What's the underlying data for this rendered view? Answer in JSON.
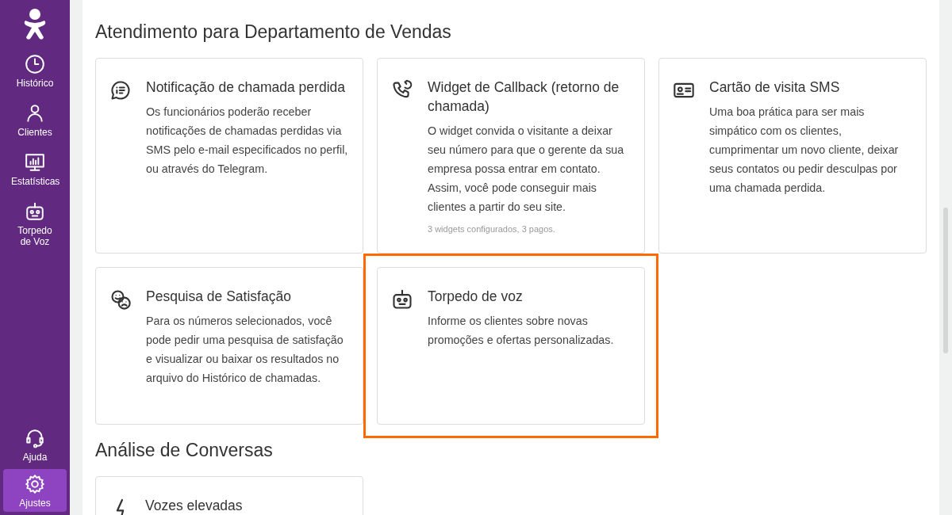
{
  "sidebar": {
    "top_items": [
      {
        "label": "Histórico",
        "selected": false
      },
      {
        "label": "Clientes",
        "selected": false
      },
      {
        "label": "Estatísticas",
        "selected": false
      },
      {
        "label": "Torpedo de Voz",
        "selected": false
      }
    ],
    "bottom_items": [
      {
        "label": "Ajuda",
        "selected": false
      },
      {
        "label": "Ajustes",
        "selected": true
      }
    ]
  },
  "sections": [
    {
      "title": "Atendimento para Departamento de Vendas",
      "cards": [
        {
          "title": "Notificação de chamada perdida",
          "description": "Os funcionários poderão receber notificações de chamadas perdidas via SMS pelo e-mail especificados no perfil, ou através do Telegram.",
          "highlighted": false
        },
        {
          "title": "Widget de Callback (retorno de chamada)",
          "description": "O widget convida o visitante a deixar seu número para que o gerente da sua empresa possa entrar em contato. Assim, você pode conseguir mais clientes a partir do seu site.",
          "note": "3 widgets configurados, 3 pagos.",
          "highlighted": false
        },
        {
          "title": "Cartão de visita SMS",
          "description": "Uma boa prática para ser mais simpático com os clientes, cumprimentar um novo cliente, deixar seus contatos ou pedir desculpas por uma chamada perdida.",
          "highlighted": false
        },
        {
          "title": "Pesquisa de Satisfação",
          "description": "Para os números selecionados, você pode pedir uma pesquisa de satisfação e visualizar ou baixar os resultados no arquivo do Histórico de chamadas.",
          "highlighted": false
        },
        {
          "title": "Torpedo de voz",
          "description": "Informe os clientes sobre novas promoções e ofertas personalizadas.",
          "highlighted": true
        }
      ]
    },
    {
      "title": "Análise de Conversas",
      "cards": [
        {
          "title": "Vozes elevadas"
        }
      ]
    }
  ]
}
